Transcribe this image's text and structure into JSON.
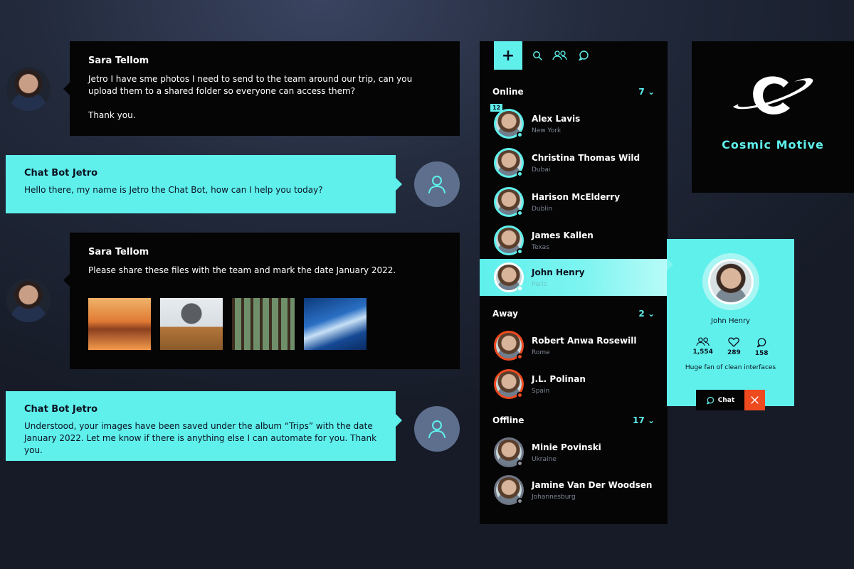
{
  "chat": {
    "messages": [
      {
        "sender": "Sara Tellom",
        "text": "Jetro I have sme photos I need to send to the team around our trip, can you upload them to a shared folder so everyone can access them?\n\nThank you."
      },
      {
        "sender": "Chat Bot Jetro",
        "text": "Hello there, my name is Jetro the Chat Bot, how can I help you today?"
      },
      {
        "sender": "Sara Tellom",
        "text": "Please share these files with the team and mark the date January 2022."
      },
      {
        "sender": "Chat Bot Jetro",
        "text": "Understood, your images have been saved under the album “Trips” with the date January 2022. Let me know if there is anything else I can automate for you. Thank you."
      }
    ]
  },
  "toolbar": {
    "add_label": "+"
  },
  "sections": {
    "online": {
      "label": "Online",
      "count": "7"
    },
    "away": {
      "label": "Away",
      "count": "2"
    },
    "offline": {
      "label": "Offline",
      "count": "17"
    }
  },
  "contacts": {
    "online": [
      {
        "name": "Alex Lavis",
        "location": "New York",
        "badge": "12"
      },
      {
        "name": "Christina Thomas Wild",
        "location": "Dubai"
      },
      {
        "name": "Harison McElderry",
        "location": "Dublin"
      },
      {
        "name": "James Kallen",
        "location": "Texas"
      },
      {
        "name": "John Henry",
        "location": "Paris"
      }
    ],
    "away": [
      {
        "name": "Robert Anwa Rosewill",
        "location": "Rome"
      },
      {
        "name": "J.L. Polinan",
        "location": "Spain"
      }
    ],
    "offline": [
      {
        "name": "Minie Povinski",
        "location": "Ukraine"
      },
      {
        "name": "Jamine Van Der Woodsen",
        "location": "Johannesburg"
      }
    ]
  },
  "profile": {
    "name": "John Henry",
    "stats": [
      {
        "icon": "users-icon",
        "value": "1,554"
      },
      {
        "icon": "heart-icon",
        "value": "289"
      },
      {
        "icon": "chat-bubble-icon",
        "value": "158"
      }
    ],
    "bio": "Huge fan of clean interfaces",
    "chat_label": "Chat"
  },
  "brand": {
    "name": "Cosmic Motive"
  },
  "colors": {
    "accent": "#5ff0ec",
    "away": "#ee4a1f",
    "panel": "#050505",
    "bot_avatar": "#5e6f8e"
  }
}
